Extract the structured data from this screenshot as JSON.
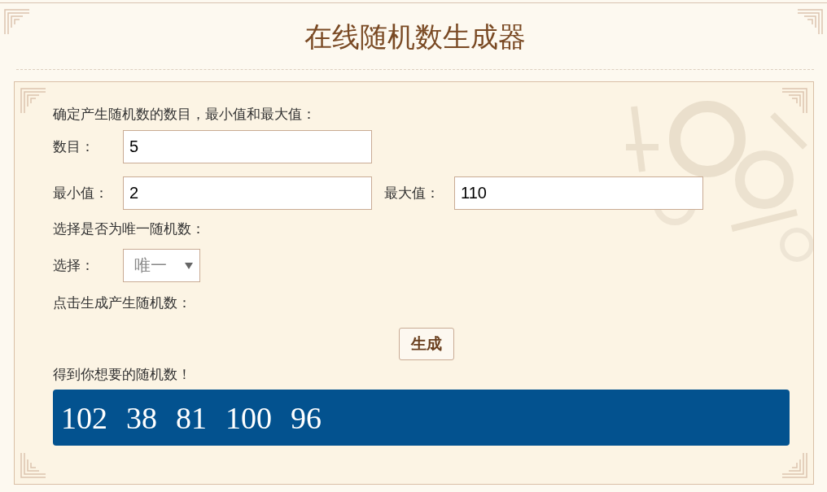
{
  "title": "在线随机数生成器",
  "intro": "确定产生随机数的数目，最小值和最大值：",
  "count_field": {
    "label": "数目：",
    "value": "5"
  },
  "min_field": {
    "label": "最小值：",
    "value": "2"
  },
  "max_field": {
    "label": "最大值：",
    "value": "110"
  },
  "unique_prompt": "选择是否为唯一随机数：",
  "select": {
    "label": "选择：",
    "value": "唯一"
  },
  "generate_prompt": "点击生成产生随机数：",
  "generate_button": "生成",
  "result_prompt": "得到你想要的随机数！",
  "results": [
    "102",
    "38",
    "81",
    "100",
    "96"
  ]
}
